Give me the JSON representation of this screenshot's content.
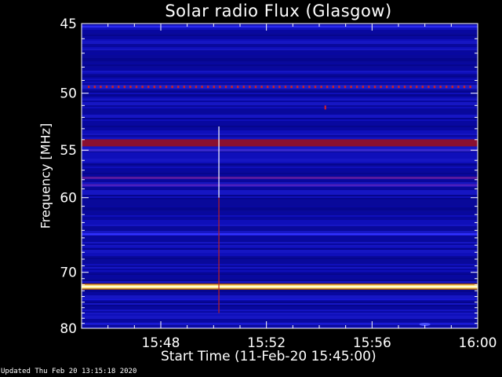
{
  "chart_data": {
    "type": "heatmap",
    "title": "Solar radio Flux (Glasgow)",
    "xlabel": "Start Time (11-Feb-20 15:45:00)",
    "ylabel": "Frequency [MHz]",
    "x_ticks": [
      "15:48",
      "15:52",
      "15:56",
      "16:00"
    ],
    "x_tick_minutes": [
      3,
      7,
      11,
      15
    ],
    "xlim_minutes": [
      0,
      15
    ],
    "y_ticks": [
      45,
      50,
      55,
      60,
      70,
      80
    ],
    "ylim": [
      45,
      80
    ],
    "y_scale": "reciprocal",
    "background_colors": [
      "#0a0a9a",
      "#1212c4",
      "#0808a0",
      "#1b1bd0",
      "#060688"
    ],
    "bands": [
      {
        "freq": 45.2,
        "intensity": "medium",
        "color": "#2a2af0"
      },
      {
        "freq": 49.5,
        "intensity": "dashed-red",
        "color": "#d02020"
      },
      {
        "freq": 54.3,
        "intensity": "high",
        "color": "#8a1030"
      },
      {
        "freq": 55.0,
        "intensity": "medium",
        "color": "#3a2ad0"
      },
      {
        "freq": 57.8,
        "intensity": "medium",
        "color": "#5a1aa0"
      },
      {
        "freq": 58.6,
        "intensity": "medium",
        "color": "#4a20c0"
      },
      {
        "freq": 64.5,
        "intensity": "medium",
        "color": "#3030ff"
      },
      {
        "freq": 72.3,
        "intensity": "very-high",
        "color": "#ffe070"
      },
      {
        "freq": 74.5,
        "intensity": "low",
        "color": "#1818d8"
      },
      {
        "freq": 76.5,
        "intensity": "low",
        "color": "#1515c8"
      },
      {
        "freq": 79.0,
        "intensity": "low",
        "color": "#1a1ad8"
      }
    ],
    "spike": {
      "time_minutes": 5.2,
      "freq_min": 52.8,
      "freq_max": 77
    },
    "colors": {
      "axis": "#ffffff",
      "text": "#ffffff",
      "background": "#000000"
    }
  },
  "footer": "Updated Thu Feb 20 13:15:18 2020"
}
